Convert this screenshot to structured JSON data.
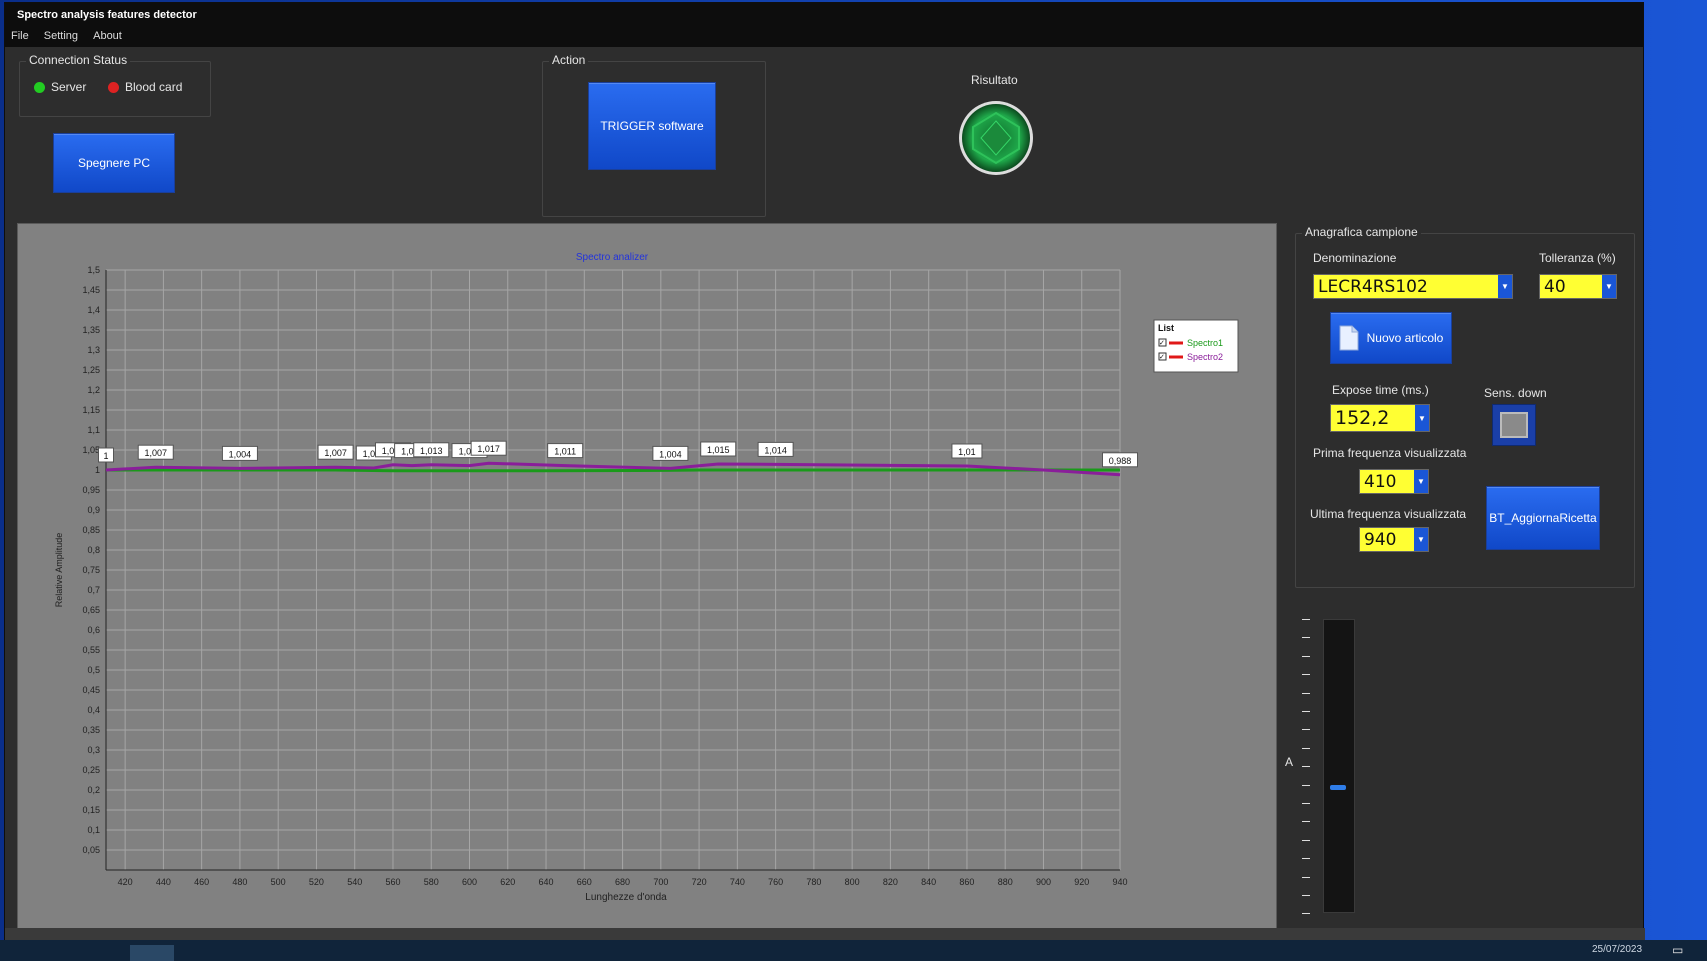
{
  "window": {
    "title": "Spectro analysis features detector"
  },
  "menu": [
    "File",
    "Setting",
    "About"
  ],
  "connection": {
    "legend": "Connection Status",
    "server_label": "Server",
    "blood_label": "Blood card",
    "server_color": "#22cc22",
    "blood_color": "#dd2222"
  },
  "buttons": {
    "shutdown": "Spegnere PC",
    "trigger": "TRIGGER software",
    "new_article": "Nuovo articolo",
    "update_recipe": "BT_AggiornaRicetta"
  },
  "action": {
    "legend": "Action"
  },
  "result": {
    "label": "Risultato",
    "color": "#1fa84a"
  },
  "sample": {
    "legend": "Anagrafica campione",
    "name_label": "Denominazione",
    "name_value": "LECR4RS102",
    "tolerance_label": "Tolleranza (%)",
    "tolerance_value": "40",
    "expose_label": "Expose time (ms.)",
    "expose_value": "152,2",
    "sens_label": "Sens. down",
    "first_freq_label": "Prima frequenza visualizzata",
    "first_freq_value": "410",
    "last_freq_label": "Ultima frequenza visualizzata",
    "last_freq_value": "940"
  },
  "slider": {
    "label": "A",
    "level": 0.44
  },
  "taskbar": {
    "date": "25/07/2023"
  },
  "chart_data": {
    "type": "line",
    "title": "Spectro analizer",
    "xlabel": "Lunghezze d'onda",
    "ylabel": "Relative Amplitude",
    "xlim": [
      410,
      940
    ],
    "ylim": [
      0,
      1.5
    ],
    "xticks": [
      420,
      440,
      460,
      480,
      500,
      520,
      540,
      560,
      580,
      600,
      620,
      640,
      660,
      680,
      700,
      720,
      740,
      760,
      780,
      800,
      820,
      840,
      860,
      880,
      900,
      920,
      940
    ],
    "yticks": [
      "0,05",
      "0,1",
      "0,15",
      "0,2",
      "0,25",
      "0,3",
      "0,35",
      "0,4",
      "0,45",
      "0,5",
      "0,55",
      "0,6",
      "0,65",
      "0,7",
      "0,75",
      "0,8",
      "0,85",
      "0,9",
      "0,95",
      "1",
      "1,05",
      "1,1",
      "1,15",
      "1,2",
      "1,25",
      "1,3",
      "1,35",
      "1,4",
      "1,45",
      "1,5"
    ],
    "legend_title": "List",
    "grid": true,
    "legend_position": "top-right",
    "series": [
      {
        "name": "Spectro1",
        "color": "#1a9a1a",
        "x": [
          410,
          440,
          480,
          530,
          560,
          600,
          640,
          700,
          720,
          740,
          760,
          800,
          860,
          900,
          940
        ],
        "y": [
          1.0,
          1.0,
          1.0,
          1.0,
          0.998,
          0.998,
          0.998,
          0.999,
          1.0,
          1.0,
          1.0,
          1.0,
          1.0,
          1.0,
          1.0
        ]
      },
      {
        "name": "Spectro2",
        "color": "#8a1e9a",
        "x": [
          410,
          436,
          480,
          530,
          550,
          560,
          570,
          580,
          600,
          610,
          650,
          705,
          730,
          760,
          860,
          900,
          940
        ],
        "y": [
          1.0,
          1.007,
          1.004,
          1.007,
          1.005,
          1.013,
          1.011,
          1.013,
          1.011,
          1.017,
          1.011,
          1.004,
          1.015,
          1.014,
          1.01,
          1.0,
          0.988
        ]
      }
    ],
    "data_labels": [
      {
        "x": 410,
        "y": 1.0,
        "text": "1"
      },
      {
        "x": 436,
        "y": 1.007,
        "text": "1,007"
      },
      {
        "x": 480,
        "y": 1.004,
        "text": "1,004"
      },
      {
        "x": 530,
        "y": 1.007,
        "text": "1,007"
      },
      {
        "x": 550,
        "y": 1.005,
        "text": "1,005"
      },
      {
        "x": 560,
        "y": 1.013,
        "text": "1,013"
      },
      {
        "x": 570,
        "y": 1.011,
        "text": "1,011"
      },
      {
        "x": 580,
        "y": 1.013,
        "text": "1,013"
      },
      {
        "x": 600,
        "y": 1.011,
        "text": "1,011"
      },
      {
        "x": 610,
        "y": 1.017,
        "text": "1,017"
      },
      {
        "x": 650,
        "y": 1.011,
        "text": "1,011"
      },
      {
        "x": 705,
        "y": 1.004,
        "text": "1,004"
      },
      {
        "x": 730,
        "y": 1.015,
        "text": "1,015"
      },
      {
        "x": 760,
        "y": 1.014,
        "text": "1,014"
      },
      {
        "x": 860,
        "y": 1.01,
        "text": "1,01"
      },
      {
        "x": 940,
        "y": 0.988,
        "text": "0,988"
      }
    ]
  }
}
